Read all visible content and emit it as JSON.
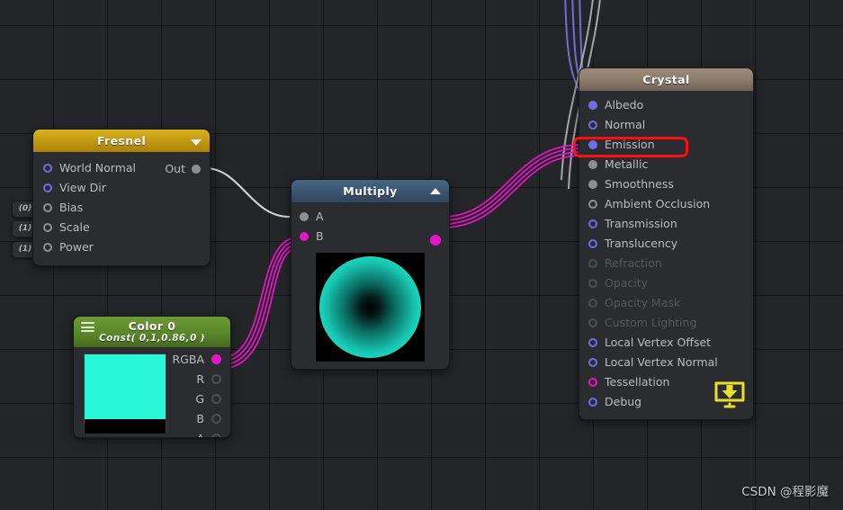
{
  "watermark": "CSDN @程影魔",
  "colors": {
    "wire_magenta": "#e616c8",
    "wire_purple": "#7a6fe0",
    "wire_white": "#cfd2d6",
    "annotation_red": "#fb0f0f",
    "color0_swatch": "#2bf5d8",
    "fresnel_header": "#c39a12",
    "multiply_header": "#3d5671",
    "crystal_header": "#8c7c6b",
    "color0_header": "#5c8a2b"
  },
  "left_chips": [
    {
      "label": "(0)"
    },
    {
      "label": "(1)"
    },
    {
      "label": "(1)"
    }
  ],
  "nodes": {
    "fresnel": {
      "title": "Fresnel",
      "collapse_icon": "chevron-down-icon",
      "inputs": [
        {
          "label": "World Normal",
          "style": "h-blue"
        },
        {
          "label": "View Dir",
          "style": "h-blue"
        },
        {
          "label": "Bias",
          "style": "h-gray"
        },
        {
          "label": "Scale",
          "style": "h-gray"
        },
        {
          "label": "Power",
          "style": "h-gray"
        }
      ],
      "output": {
        "label": "Out",
        "style": "f-gray"
      }
    },
    "color0": {
      "title": "Color 0",
      "subtitle": "Const( 0,1,0.86,0 )",
      "menu_icon": "hamburger-icon",
      "swatch_color": "#2bf5d8",
      "alpha_color": "#000000",
      "outputs": [
        {
          "label": "RGBA",
          "style": "f-mag"
        },
        {
          "label": "R",
          "style": "h-dgray"
        },
        {
          "label": "G",
          "style": "h-dgray"
        },
        {
          "label": "B",
          "style": "h-dgray"
        },
        {
          "label": "A",
          "style": "h-dgray"
        }
      ]
    },
    "multiply": {
      "title": "Multiply",
      "collapse_icon": "chevron-up-icon",
      "inputs": [
        {
          "label": "A",
          "style": "f-gray"
        },
        {
          "label": "B",
          "style": "f-mag"
        }
      ],
      "output": {
        "style": "f-mag"
      },
      "preview": "cyan-sphere-preview"
    },
    "crystal": {
      "title": "Crystal",
      "save_icon": "save-to-monitor-icon",
      "ports": [
        {
          "label": "Albedo",
          "style": "f-blue",
          "disabled": false
        },
        {
          "label": "Normal",
          "style": "h-blue",
          "disabled": false
        },
        {
          "label": "Emission",
          "style": "f-blue",
          "disabled": false,
          "highlighted": true
        },
        {
          "label": "Metallic",
          "style": "f-gray",
          "disabled": false
        },
        {
          "label": "Smoothness",
          "style": "f-gray",
          "disabled": false
        },
        {
          "label": "Ambient Occlusion",
          "style": "h-gray",
          "disabled": false
        },
        {
          "label": "Transmission",
          "style": "h-blue",
          "disabled": false
        },
        {
          "label": "Translucency",
          "style": "h-blue",
          "disabled": false
        },
        {
          "label": "Refraction",
          "style": "h-dgray",
          "disabled": true
        },
        {
          "label": "Opacity",
          "style": "h-dgray",
          "disabled": true
        },
        {
          "label": "Opacity Mask",
          "style": "h-dgray",
          "disabled": true
        },
        {
          "label": "Custom Lighting",
          "style": "h-dgray",
          "disabled": true
        },
        {
          "label": "Local Vertex Offset",
          "style": "h-blue",
          "disabled": false
        },
        {
          "label": "Local Vertex Normal",
          "style": "h-blue",
          "disabled": false
        },
        {
          "label": "Tessellation",
          "style": "h-mag",
          "disabled": false
        },
        {
          "label": "Debug",
          "style": "h-blue",
          "disabled": false
        }
      ]
    }
  }
}
